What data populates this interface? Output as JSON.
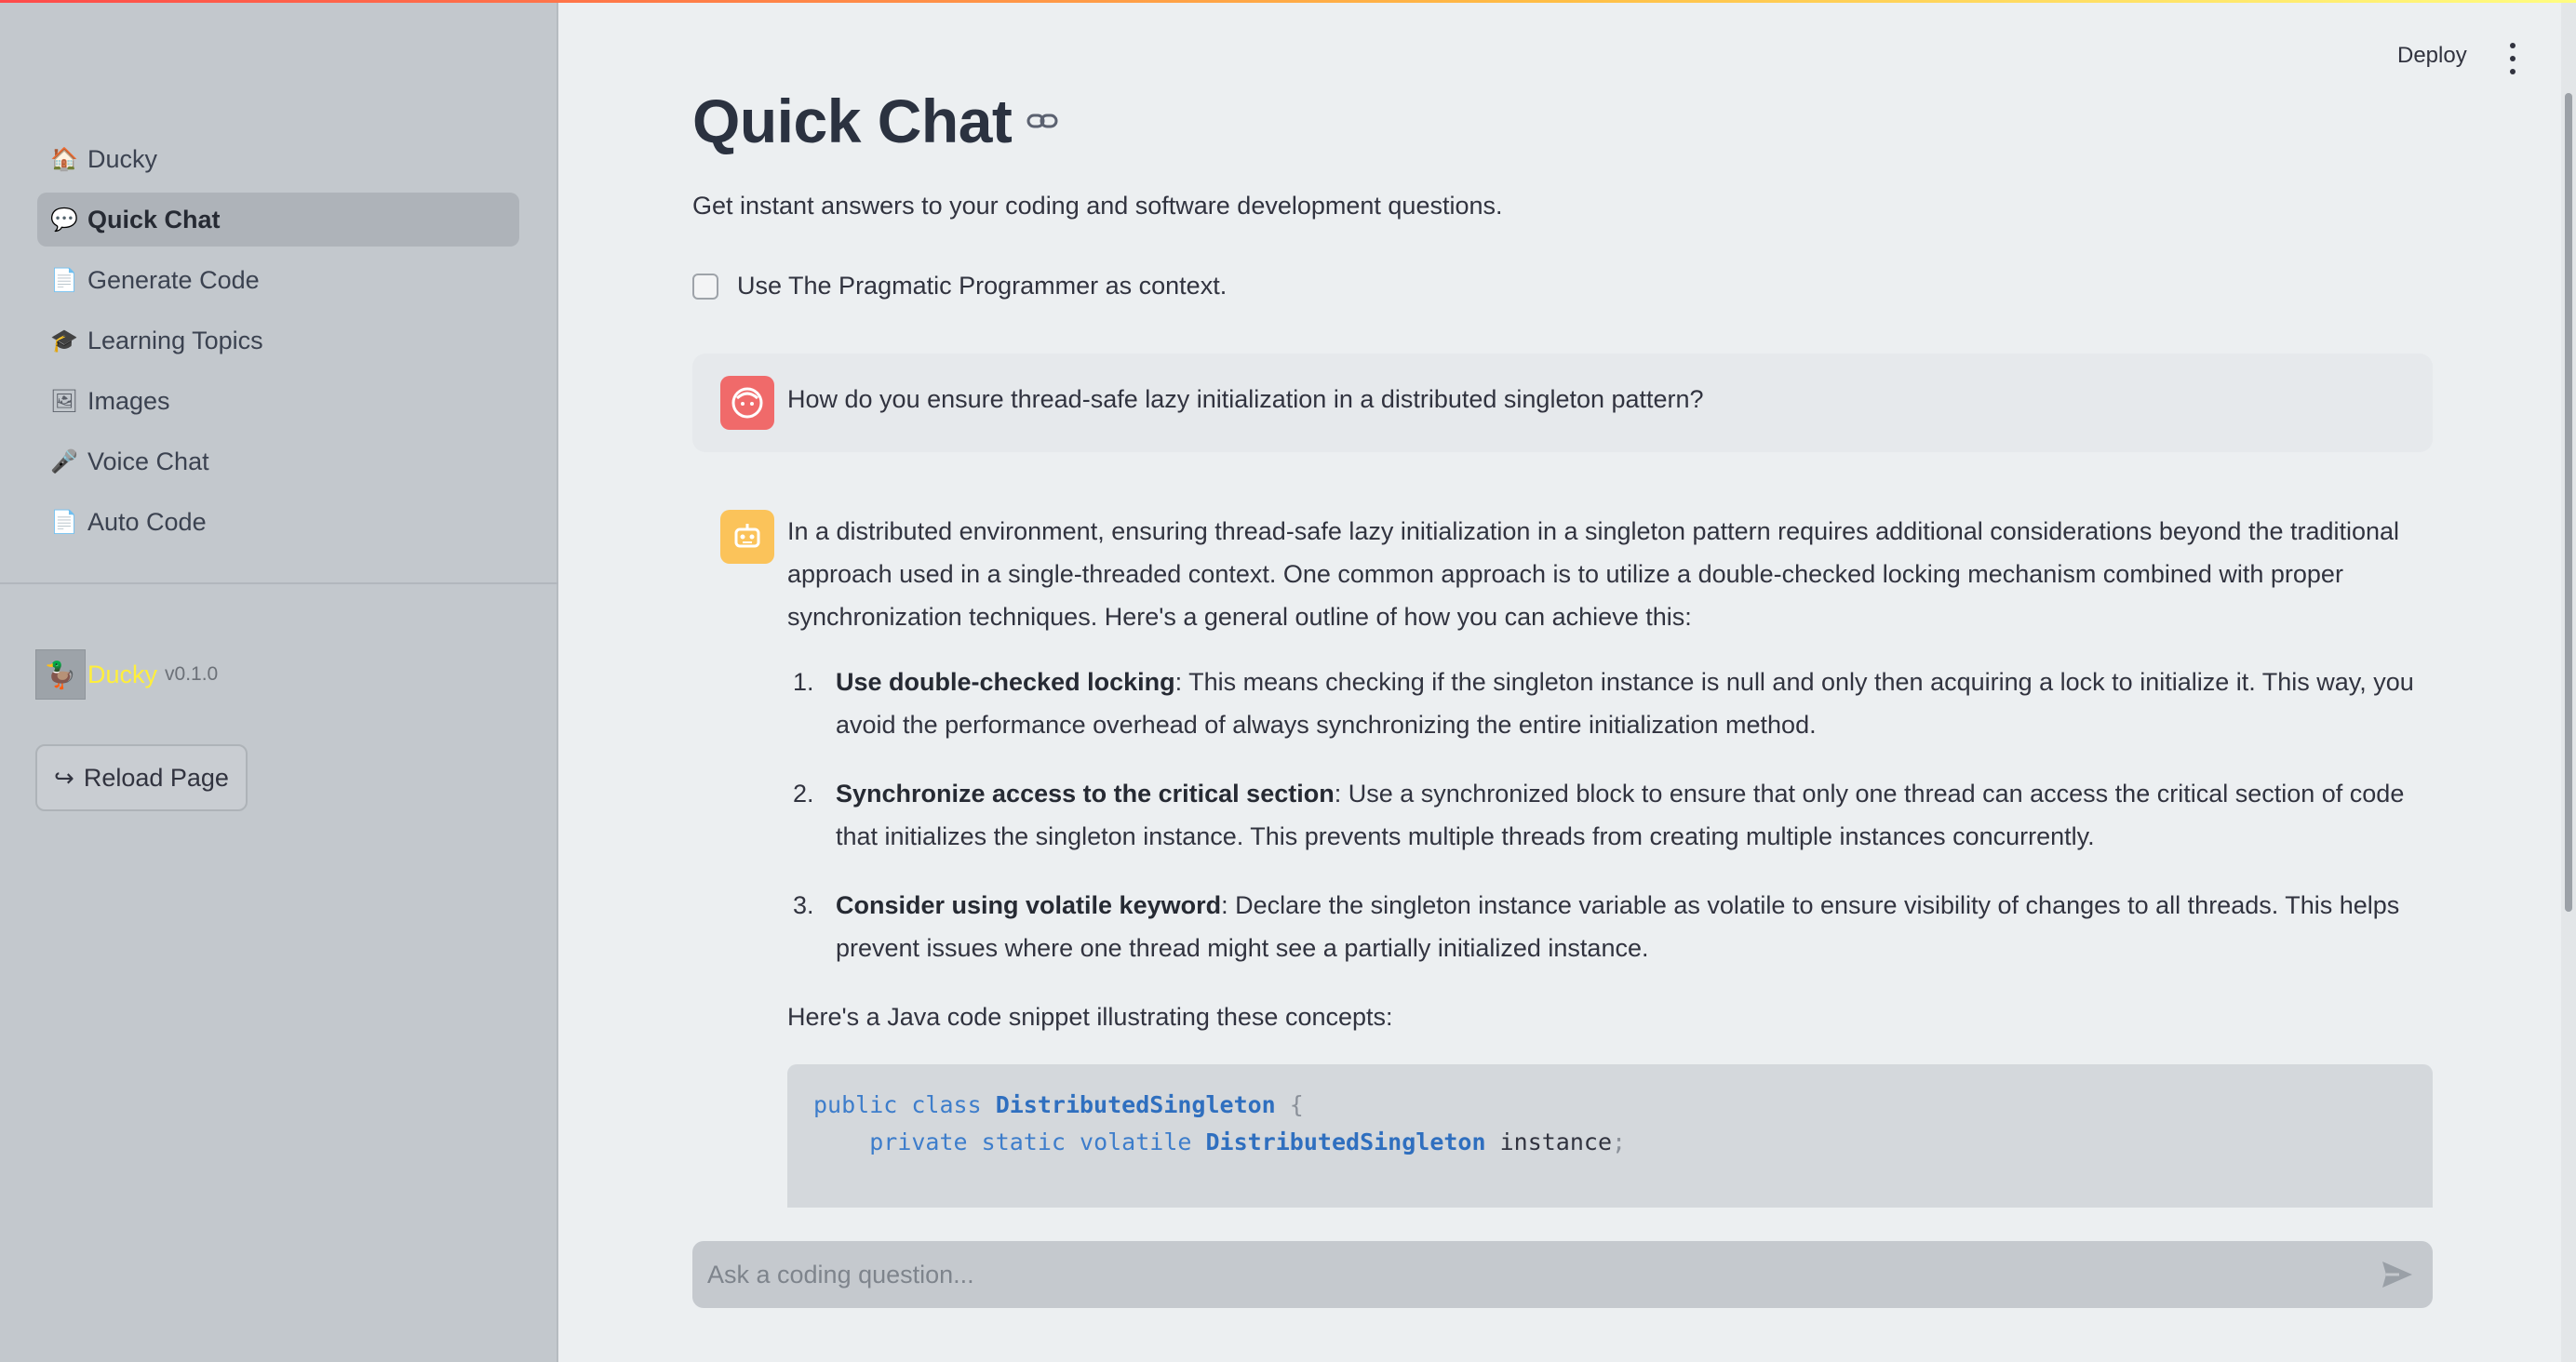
{
  "sidebar": {
    "items": [
      {
        "icon": "🏠",
        "icon_name": "house-icon",
        "label": "Ducky",
        "active": false
      },
      {
        "icon": "💬",
        "icon_name": "speech-bubble-icon",
        "label": "Quick Chat",
        "active": true
      },
      {
        "icon": "📄",
        "icon_name": "document-icon",
        "label": "Generate Code",
        "active": false
      },
      {
        "icon": "🎓",
        "icon_name": "graduation-cap-icon",
        "label": "Learning Topics",
        "active": false
      },
      {
        "icon": "🖼",
        "icon_name": "picture-icon",
        "label": "Images",
        "active": false
      },
      {
        "icon": "🎤",
        "icon_name": "microphone-icon",
        "label": "Voice Chat",
        "active": false
      },
      {
        "icon": "📄",
        "icon_name": "document-icon",
        "label": "Auto Code",
        "active": false
      }
    ],
    "brand": {
      "name": "Ducky",
      "version": "v0.1.0"
    },
    "reload_button": "Reload Page"
  },
  "header": {
    "deploy": "Deploy"
  },
  "main": {
    "title": "Quick Chat",
    "subtitle": "Get instant answers to your coding and software development questions.",
    "checkbox_label": "Use The Pragmatic Programmer as context.",
    "checkbox_checked": false
  },
  "messages": {
    "user": "How do you ensure thread-safe lazy initialization in a distributed singleton pattern?",
    "assistant": {
      "intro": "In a distributed environment, ensuring thread-safe lazy initialization in a singleton pattern requires additional considerations beyond the traditional approach used in a single-threaded context. One common approach is to utilize a double-checked locking mechanism combined with proper synchronization techniques. Here's a general outline of how you can achieve this:",
      "points": [
        {
          "num": "1.",
          "title": "Use double-checked locking",
          "text": ": This means checking if the singleton instance is null and only then acquiring a lock to initialize it. This way, you avoid the performance overhead of always synchronizing the entire initialization method."
        },
        {
          "num": "2.",
          "title": "Synchronize access to the critical section",
          "text": ": Use a synchronized block to ensure that only one thread can access the critical section of code that initializes the singleton instance. This prevents multiple threads from creating multiple instances concurrently."
        },
        {
          "num": "3.",
          "title": "Consider using volatile keyword",
          "text": ": Declare the singleton instance variable as volatile to ensure visibility of changes to all threads. This helps prevent issues where one thread might see a partially initialized instance."
        }
      ],
      "code_intro": "Here's a Java code snippet illustrating these concepts:",
      "code": {
        "line1": {
          "kw1": "public",
          "kw2": "class",
          "cls": "DistributedSingleton",
          "brace": "{"
        },
        "line2": {
          "kw1": "private",
          "kw2": "static",
          "kw3": "volatile",
          "cls": "DistributedSingleton",
          "id": "instance",
          "semi": ";"
        }
      }
    }
  },
  "chat_input": {
    "placeholder": "Ask a coding question...",
    "value": ""
  },
  "colors": {
    "sidebar_bg": "#c3c8cd",
    "main_bg": "#eceff1",
    "user_avatar": "#f06a6a",
    "bot_avatar": "#fbc35a",
    "brand_name": "#ffef3b",
    "code_keyword": "#3d7dcb"
  }
}
